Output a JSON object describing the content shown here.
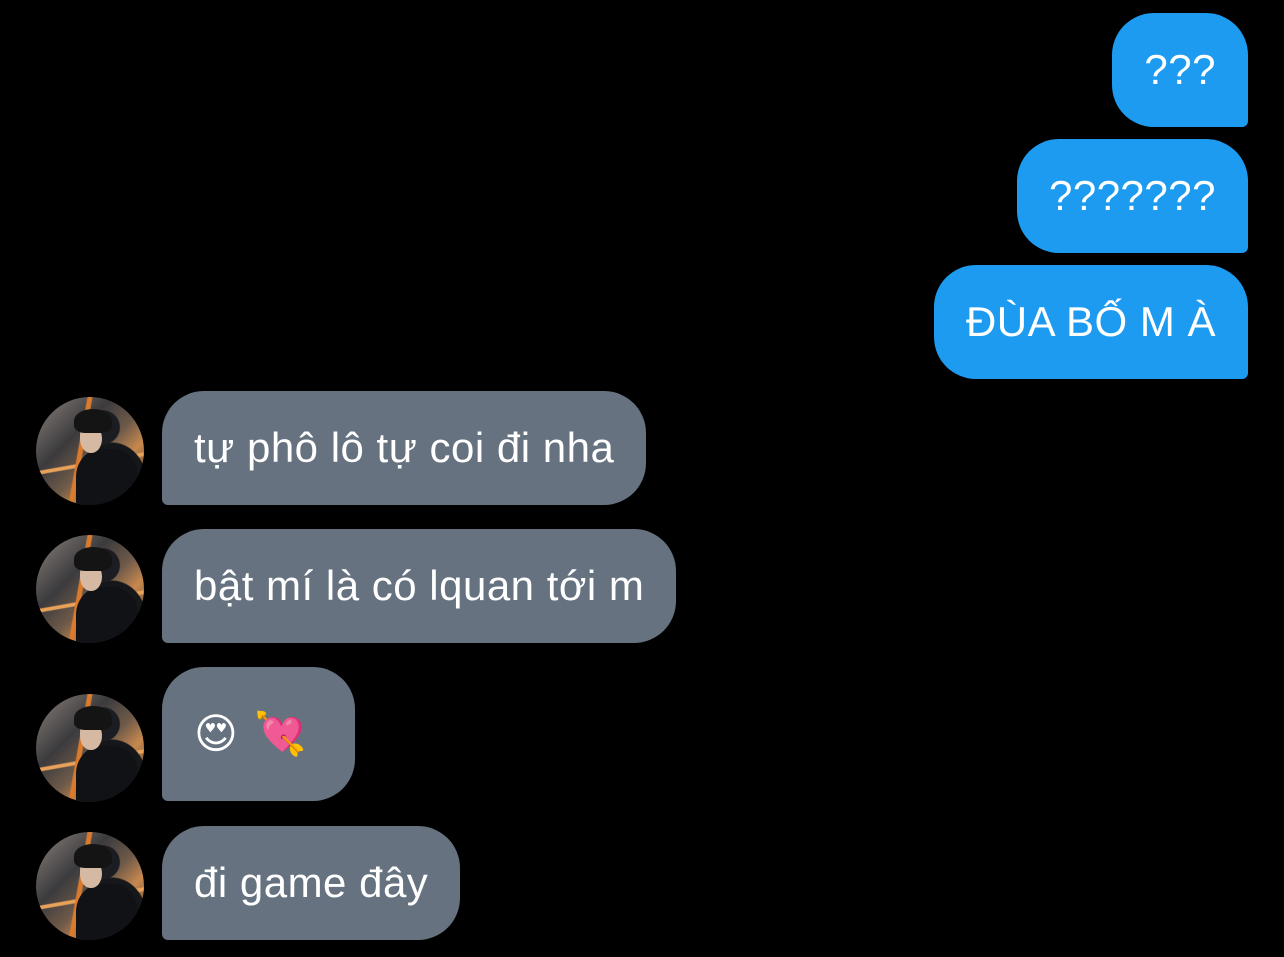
{
  "messages": [
    {
      "side": "sent",
      "text": "???"
    },
    {
      "side": "sent",
      "text": "???????"
    },
    {
      "side": "sent",
      "text": "ĐÙA BỐ M À"
    },
    {
      "side": "received",
      "text": "tự phô lô tự coi đi nha"
    },
    {
      "side": "received",
      "text": "bật mí là có lquan tới m"
    },
    {
      "side": "received",
      "emojis": [
        "😍",
        "💘"
      ]
    },
    {
      "side": "received",
      "text": "đi game đây"
    }
  ],
  "colors": {
    "background": "#000000",
    "sent_bubble": "#1d9bf0",
    "received_bubble": "#66727f",
    "text": "#ffffff"
  },
  "icons": {
    "avatar": "contact-avatar"
  }
}
